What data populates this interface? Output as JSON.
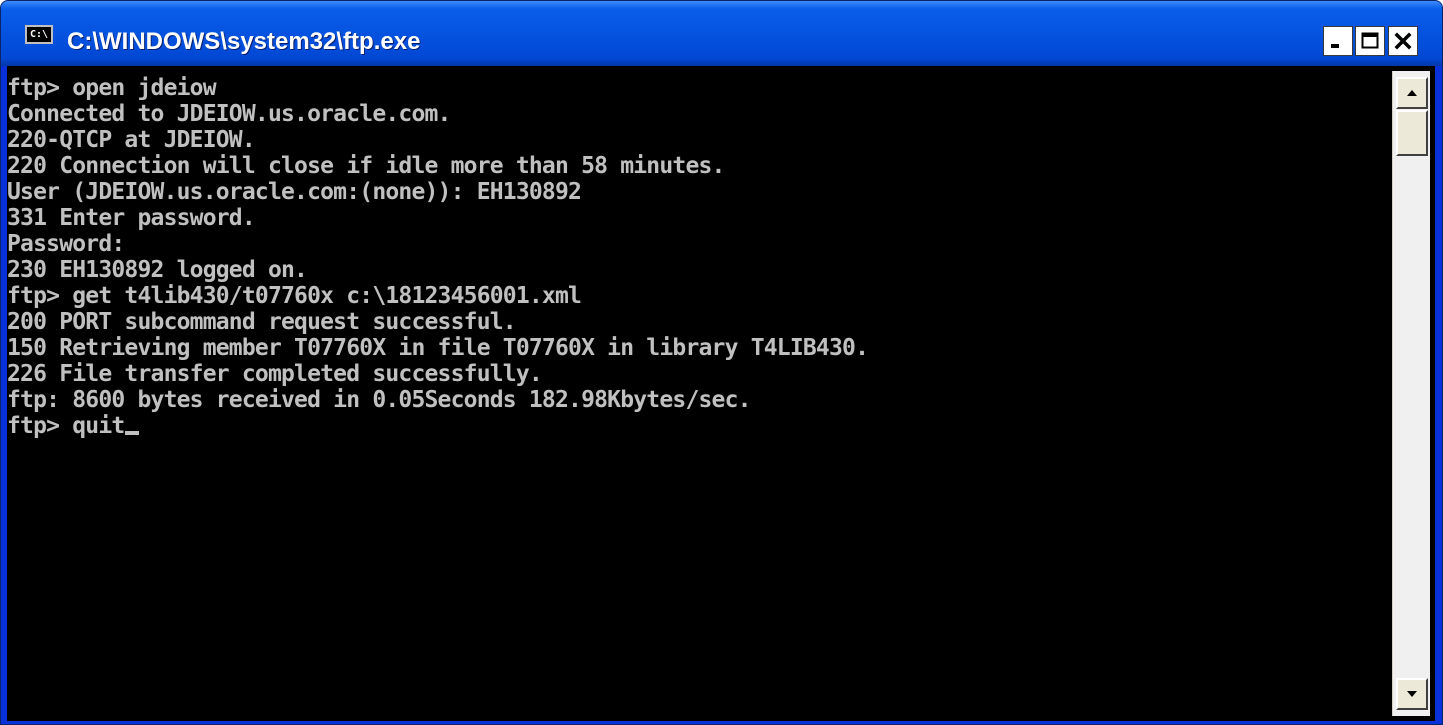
{
  "window": {
    "title": "C:\\WINDOWS\\system32\\ftp.exe",
    "icon": "console-icon",
    "icon_label": "C:\\",
    "controls": [
      "minimize-icon",
      "maximize-icon",
      "close-icon"
    ]
  },
  "console": {
    "lines": [
      "ftp> open jdeiow",
      "Connected to JDEIOW.us.oracle.com.",
      "220-QTCP at JDEIOW.",
      "220 Connection will close if idle more than 58 minutes.",
      "User (JDEIOW.us.oracle.com:(none)): EH130892",
      "331 Enter password.",
      "Password:",
      "230 EH130892 logged on.",
      "ftp> get t4lib430/t07760x c:\\18123456001.xml",
      "200 PORT subcommand request successful.",
      "150 Retrieving member T07760X in file T07760X in library T4LIB430.",
      "226 File transfer completed successfully.",
      "ftp: 8600 bytes received in 0.05Seconds 182.98Kbytes/sec.",
      "ftp> quit"
    ],
    "text_color": "#c0c0c0",
    "background_color": "#000000"
  },
  "colors": {
    "titlebar": "#0553e0",
    "close_button": "#ffffff"
  }
}
